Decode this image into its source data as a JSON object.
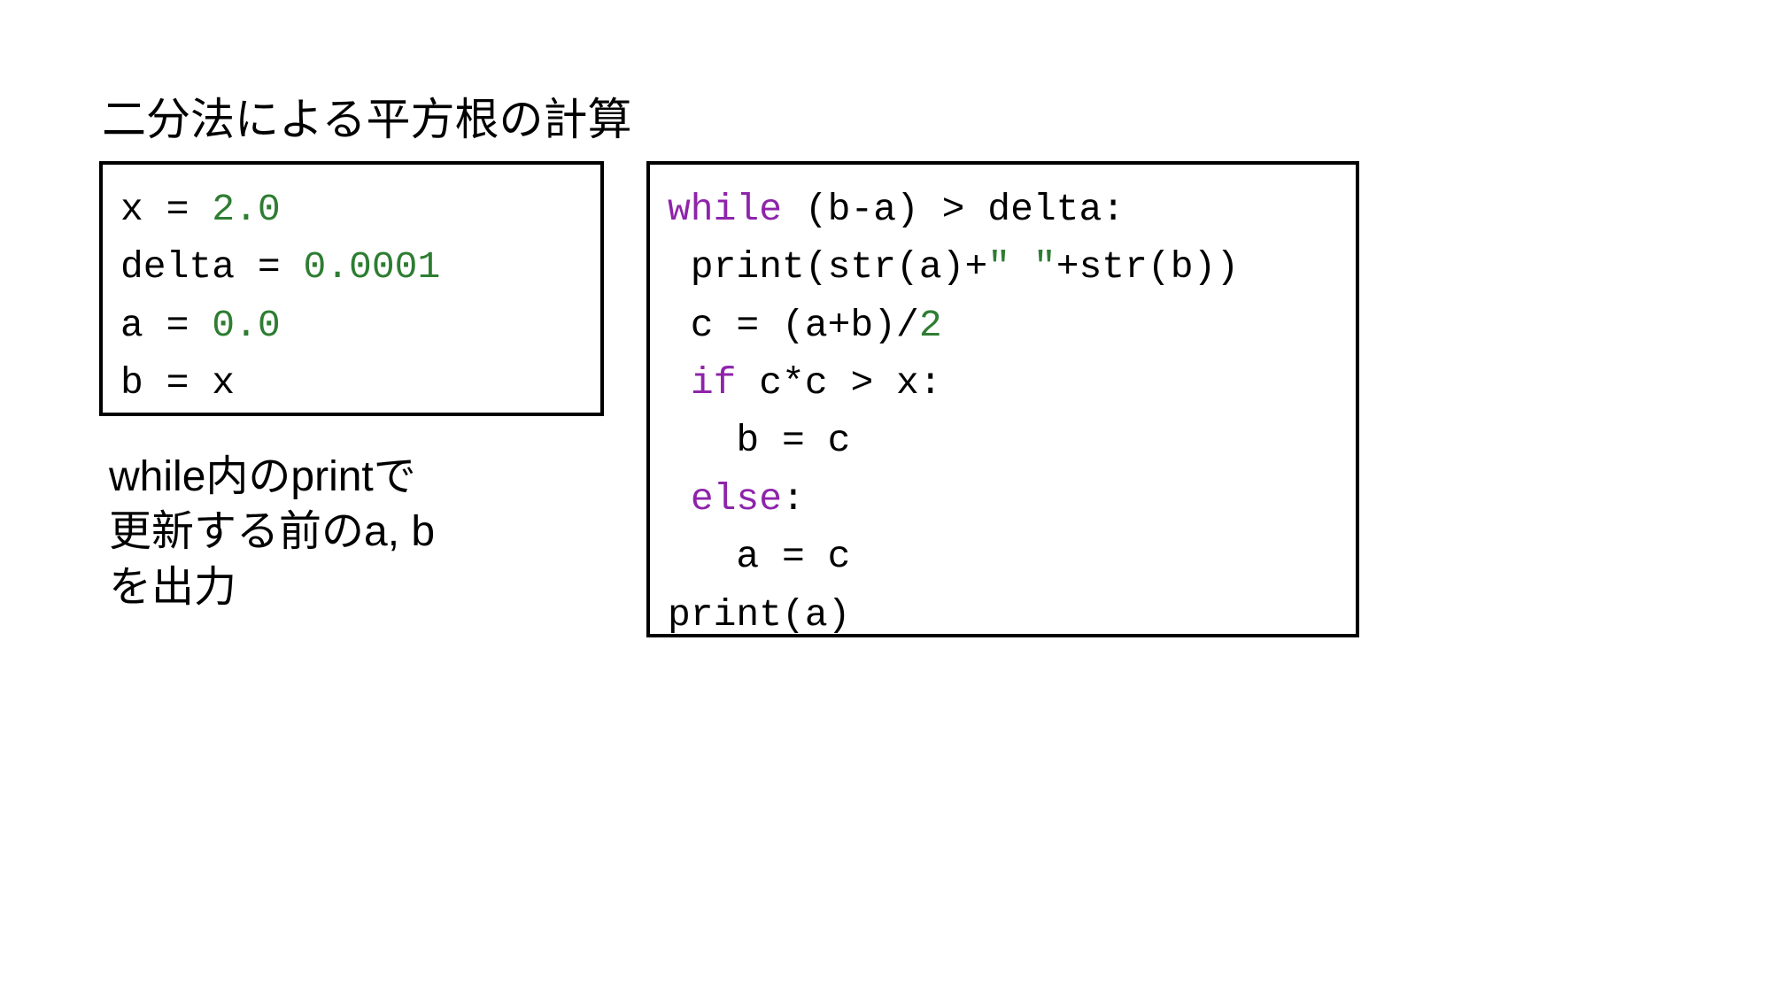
{
  "title": "二分法による平方根の計算",
  "left": {
    "l1": {
      "a": "x = ",
      "b": "2.0"
    },
    "l2": {
      "a": "delta = ",
      "b": "0.0001"
    },
    "l3": {
      "a": "a = ",
      "b": "0.0"
    },
    "l4": {
      "a": "b = x"
    }
  },
  "right": {
    "l1": {
      "a": "while",
      "b": " (b-a) > delta:"
    },
    "l2": {
      "a": " print(str(a)+",
      "b": "\" \"",
      "c": "+str(b))"
    },
    "l3": {
      "a": " c = (a+b)/",
      "b": "2"
    },
    "l4": {
      "a": " ",
      "b": "if",
      "c": " c*c > x:"
    },
    "l5": {
      "a": "   b = c"
    },
    "l6": {
      "a": " ",
      "b": "else",
      "c": ":"
    },
    "l7": {
      "a": "   a = c"
    },
    "l8": {
      "a": "print(a)"
    }
  },
  "note": "while内のprintで\n更新する前のa, b\nを出力"
}
